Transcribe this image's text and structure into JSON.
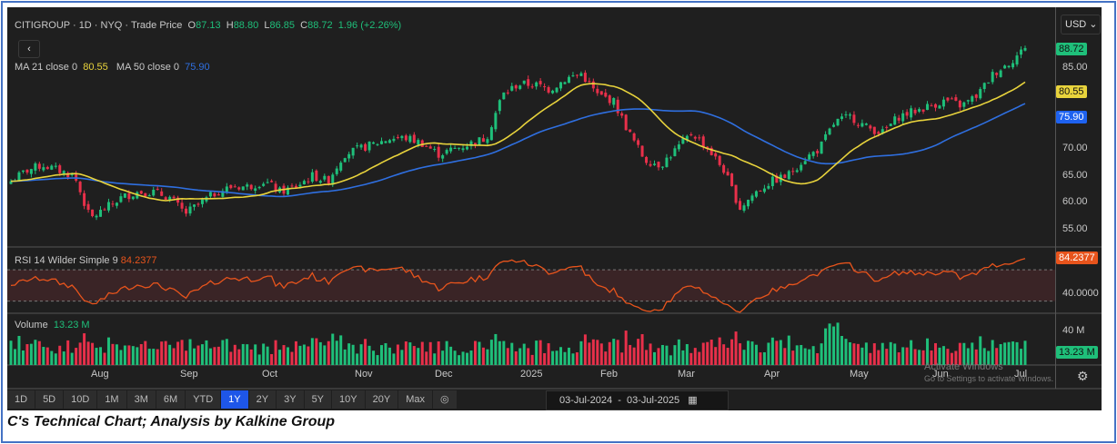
{
  "header": {
    "symbol": "CITIGROUP · 1D · NYQ · Trade Price",
    "o_label": "O",
    "o": "87.13",
    "h_label": "H",
    "h": "88.80",
    "l_label": "L",
    "l": "86.85",
    "c_label": "C",
    "c": "88.72",
    "change": "1.96 (+2.26%)",
    "back": "‹",
    "currency": "USD ⌄"
  },
  "legend": {
    "ma21_label": "MA 21 close 0",
    "ma21": "80.55",
    "ma50_label": "MA 50 close 0",
    "ma50": "75.90"
  },
  "rsi": {
    "label": "RSI 14 Wilder Simple 9",
    "value": "84.2377",
    "axis": "40.0000"
  },
  "volume": {
    "label": "Volume",
    "value": "13.23 M",
    "axis": "40 M"
  },
  "price_tags": {
    "last": "88.72",
    "ma21": "80.55",
    "ma50": "75.90"
  },
  "price_axis": [
    "85.00",
    "70.00",
    "65.00",
    "60.00",
    "55.00"
  ],
  "months": [
    "Aug",
    "Sep",
    "Oct",
    "Nov",
    "Dec",
    "2025",
    "Feb",
    "Mar",
    "Apr",
    "May",
    "Jun",
    "Jul"
  ],
  "ranges": [
    "1D",
    "5D",
    "10D",
    "1M",
    "3M",
    "6M",
    "YTD",
    "1Y",
    "2Y",
    "3Y",
    "5Y",
    "10Y",
    "20Y",
    "Max"
  ],
  "active_range": "1Y",
  "date_range": {
    "from": "03-Jul-2024",
    "sep": "-",
    "to": "03-Jul-2025"
  },
  "watermark": {
    "line1": "Activate Windows",
    "line2": "Go to Settings to activate Windows."
  },
  "caption": "C's Technical Chart; Analysis by Kalkine Group",
  "colors": {
    "up": "#1fbf7a",
    "down": "#e8304a",
    "ma21": "#e8d33c",
    "ma50": "#2f6fe0",
    "rsi": "#e8541c"
  },
  "chart_data": {
    "type": "candlestick",
    "ylim": [
      52,
      90
    ],
    "weekly_closes": [
      64,
      66,
      67,
      66,
      65,
      57,
      59,
      61,
      62,
      62,
      61,
      58,
      60,
      62,
      63,
      63,
      64,
      62,
      63,
      65,
      64,
      69,
      70,
      71,
      72,
      72,
      71,
      69,
      70,
      71,
      72,
      80,
      82,
      82,
      81,
      83,
      84,
      80,
      79,
      73,
      68,
      67,
      70,
      73,
      70,
      66,
      59,
      62,
      64,
      65,
      68,
      70,
      75,
      76,
      74,
      73,
      76,
      77,
      78,
      79,
      78,
      80,
      84,
      86,
      88.72
    ]
  }
}
